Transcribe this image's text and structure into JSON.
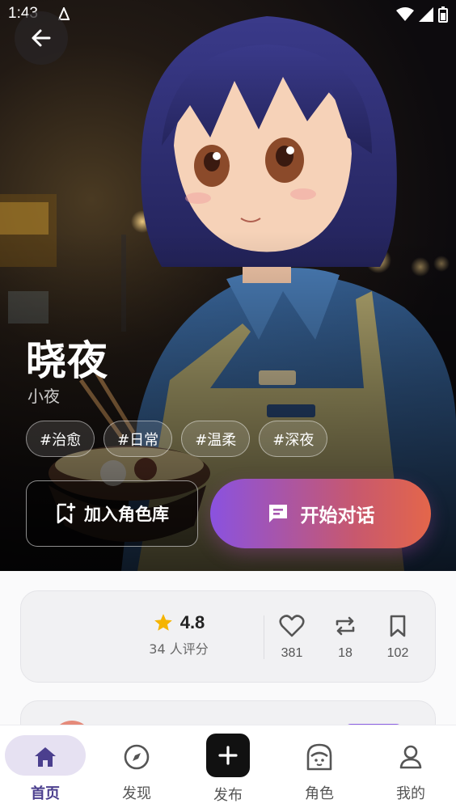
{
  "status_bar": {
    "time": "1:43"
  },
  "character": {
    "name": "晓夜",
    "nickname": "小夜",
    "tags": [
      "#治愈",
      "#日常",
      "#温柔",
      "#深夜"
    ]
  },
  "actions": {
    "add_to_library": "加入角色库",
    "start_chat": "开始对话"
  },
  "stats": {
    "rating": "4.8",
    "rating_count": "34 人评分",
    "likes": "381",
    "reposts": "18",
    "bookmarks": "102"
  },
  "nav": {
    "items": [
      {
        "label": "首页",
        "icon": "home-icon",
        "active": true
      },
      {
        "label": "发现",
        "icon": "compass-icon",
        "active": false
      },
      {
        "label": "发布",
        "icon": "plus-icon",
        "active": false
      },
      {
        "label": "角色",
        "icon": "character-icon",
        "active": false
      },
      {
        "label": "我的",
        "icon": "profile-icon",
        "active": false
      }
    ]
  },
  "colors": {
    "accent": "#4b3f8e",
    "chat_gradient_start": "#8a52e0",
    "chat_gradient_end": "#e4664a",
    "star": "#f5b400"
  }
}
